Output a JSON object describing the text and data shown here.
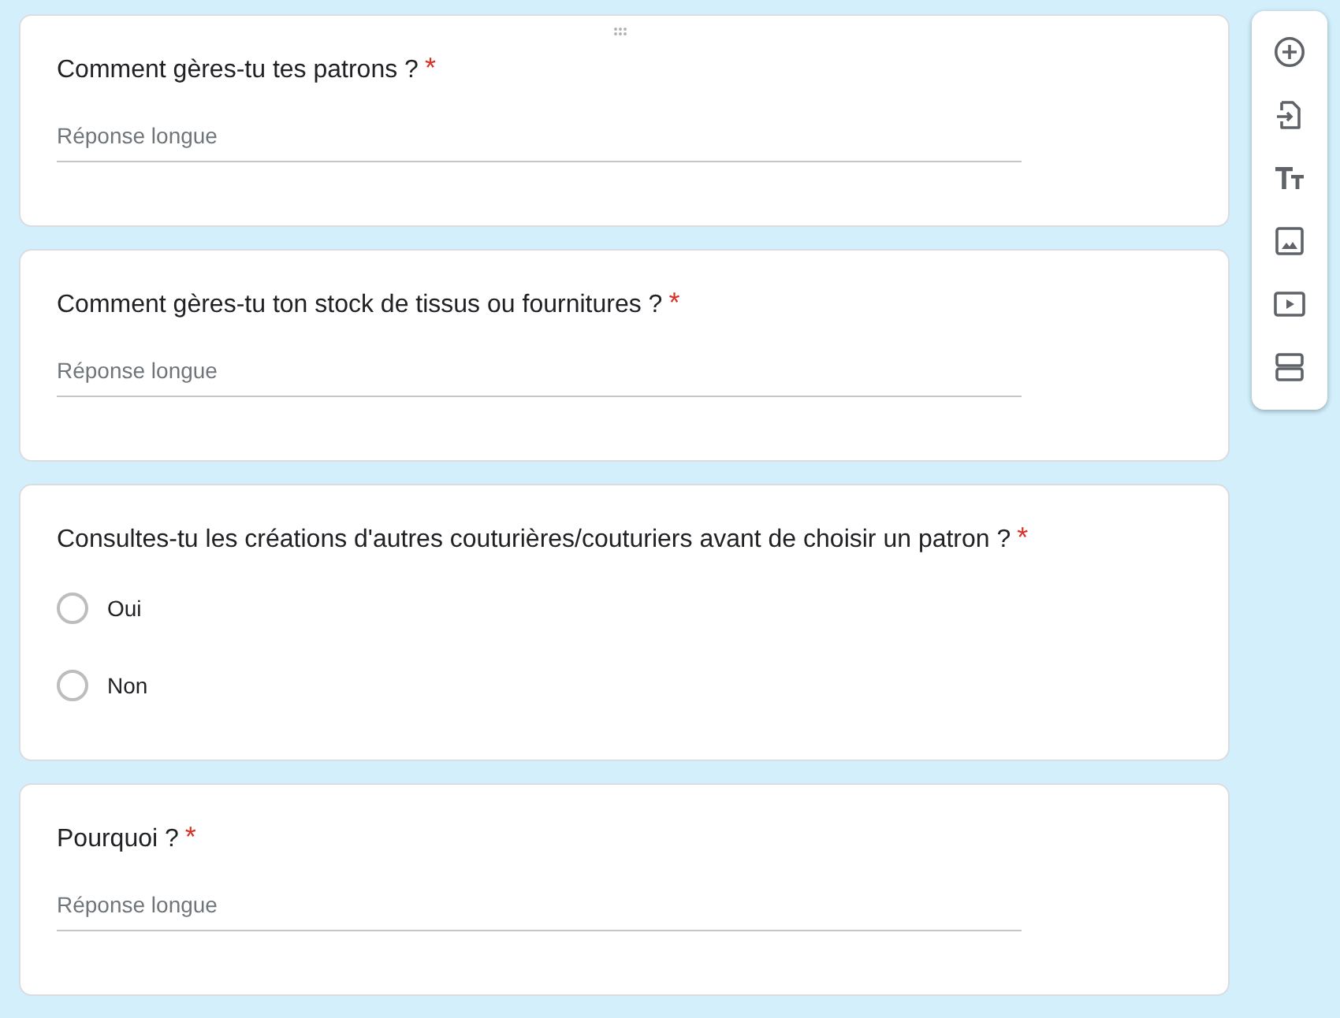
{
  "questions": [
    {
      "kind": "paragraph",
      "title": "Comment gères-tu tes patrons ?",
      "required": true,
      "placeholder": "Réponse longue",
      "drag_handle": true
    },
    {
      "kind": "paragraph",
      "title": "Comment gères-tu ton stock de tissus ou fournitures ?",
      "required": true,
      "placeholder": "Réponse longue",
      "drag_handle": false
    },
    {
      "kind": "choice",
      "title": "Consultes-tu les créations d'autres couturières/couturiers avant de choisir un patron ?",
      "required": true,
      "options": [
        {
          "label": "Oui",
          "selected": false
        },
        {
          "label": "Non",
          "selected": false
        }
      ],
      "drag_handle": false
    },
    {
      "kind": "paragraph",
      "title": "Pourquoi ?",
      "required": true,
      "placeholder": "Réponse longue",
      "drag_handle": false
    }
  ],
  "toolbar": [
    {
      "kind": "add"
    },
    {
      "kind": "import"
    },
    {
      "kind": "title"
    },
    {
      "kind": "image"
    },
    {
      "kind": "video"
    },
    {
      "kind": "section"
    }
  ],
  "required_mark": "*"
}
